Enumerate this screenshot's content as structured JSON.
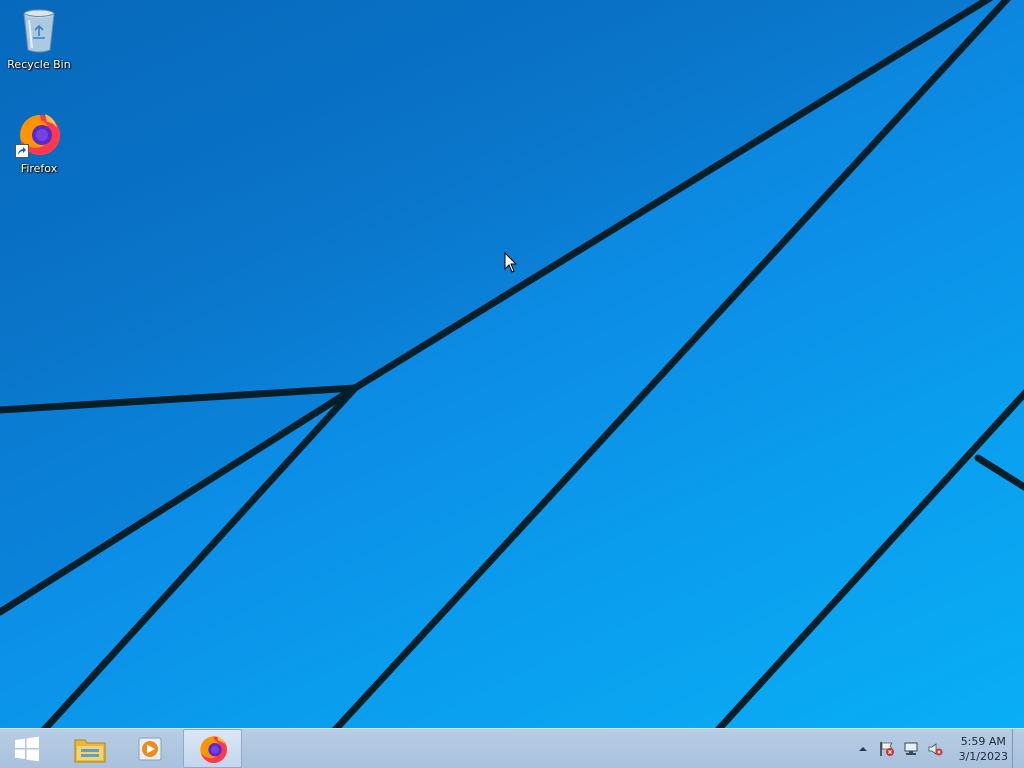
{
  "desktop": {
    "icons": [
      {
        "label": "Recycle Bin",
        "icon": "recycle-bin-icon"
      },
      {
        "label": "Firefox",
        "icon": "firefox-icon"
      }
    ]
  },
  "taskbar": {
    "start_icon": "windows-logo-icon",
    "pinned": [
      {
        "icon": "file-explorer-icon"
      },
      {
        "icon": "media-player-icon"
      },
      {
        "icon": "firefox-icon",
        "active": true
      }
    ],
    "tray": {
      "icons": [
        "show-hidden-icons-arrow",
        "action-center-flag-icon",
        "network-icon",
        "volume-muted-icon"
      ],
      "time": "5:59 AM",
      "date": "3/1/2023"
    }
  },
  "colors": {
    "wallpaper_blue": "#0c8ee6",
    "taskbar": "#b8cde4",
    "wallpaper_lines": "#04202c"
  }
}
